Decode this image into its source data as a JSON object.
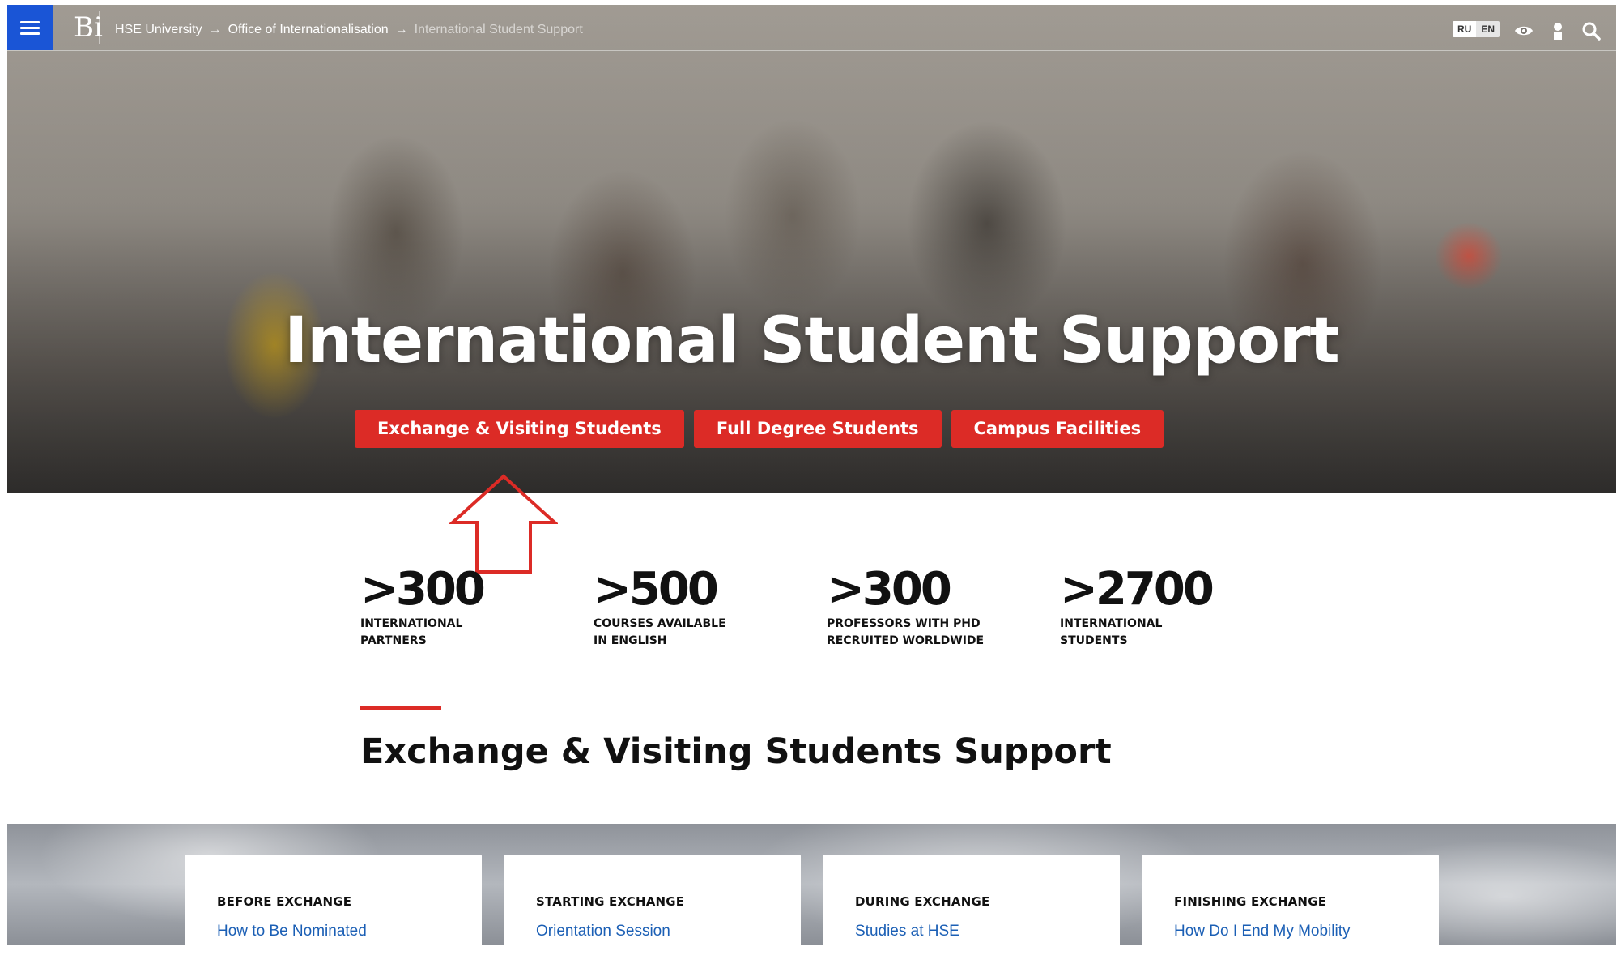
{
  "header": {
    "breadcrumb": [
      "HSE University",
      "Office of Internationalisation",
      "International Student Support"
    ],
    "breadcrumb_separator": "→",
    "languages": [
      "RU",
      "EN"
    ],
    "logo_text": "Ві"
  },
  "hero": {
    "title": "International Student Support",
    "buttons": [
      "Exchange & Visiting Students",
      "Full Degree Students",
      "Campus Facilities"
    ]
  },
  "stats": [
    {
      "value": ">300",
      "label": "INTERNATIONAL PARTNERS"
    },
    {
      "value": ">500",
      "label": "COURSES AVAILABLE IN ENGLISH"
    },
    {
      "value": ">300",
      "label": "PROFESSORS WITH PHD RECRUITED WORLDWIDE"
    },
    {
      "value": ">2700",
      "label": "INTERNATIONAL STUDENTS"
    }
  ],
  "section": {
    "title": "Exchange & Visiting Students Support"
  },
  "cards": [
    {
      "heading": "BEFORE EXCHANGE",
      "link": "How to Be Nominated"
    },
    {
      "heading": "STARTING EXCHANGE",
      "link": "Orientation Session"
    },
    {
      "heading": "DURING EXCHANGE",
      "link": "Studies at HSE"
    },
    {
      "heading": "FINISHING EXCHANGE",
      "link": "How Do I End My Mobility"
    }
  ],
  "colors": {
    "accent": "#dc2b26",
    "menu_blue": "#1a55d6",
    "link": "#1b5fb5"
  },
  "icons": [
    "menu-icon",
    "eye-icon",
    "user-icon",
    "search-icon",
    "arrow-up-annotation"
  ]
}
